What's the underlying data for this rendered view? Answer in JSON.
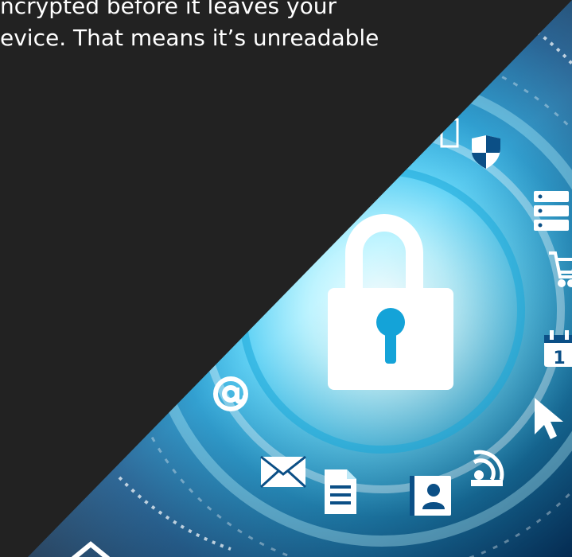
{
  "hero": {
    "text_lines": [
      "ncrypted before it leaves your",
      "evice. That means it’s unreadable"
    ],
    "icons": [
      "padlock-icon",
      "shield-icon",
      "server-icon",
      "shopping-cart-icon",
      "calendar-icon",
      "cursor-icon",
      "at-sign-icon",
      "envelope-icon",
      "document-icon",
      "contact-book-icon",
      "wifi-signal-icon",
      "house-icon"
    ],
    "calendar_number": "1",
    "colors": {
      "dark_panel": "#222222",
      "accent_cyan": "#3cc6f2",
      "deep_blue": "#0b4f86",
      "white": "#ffffff"
    }
  }
}
